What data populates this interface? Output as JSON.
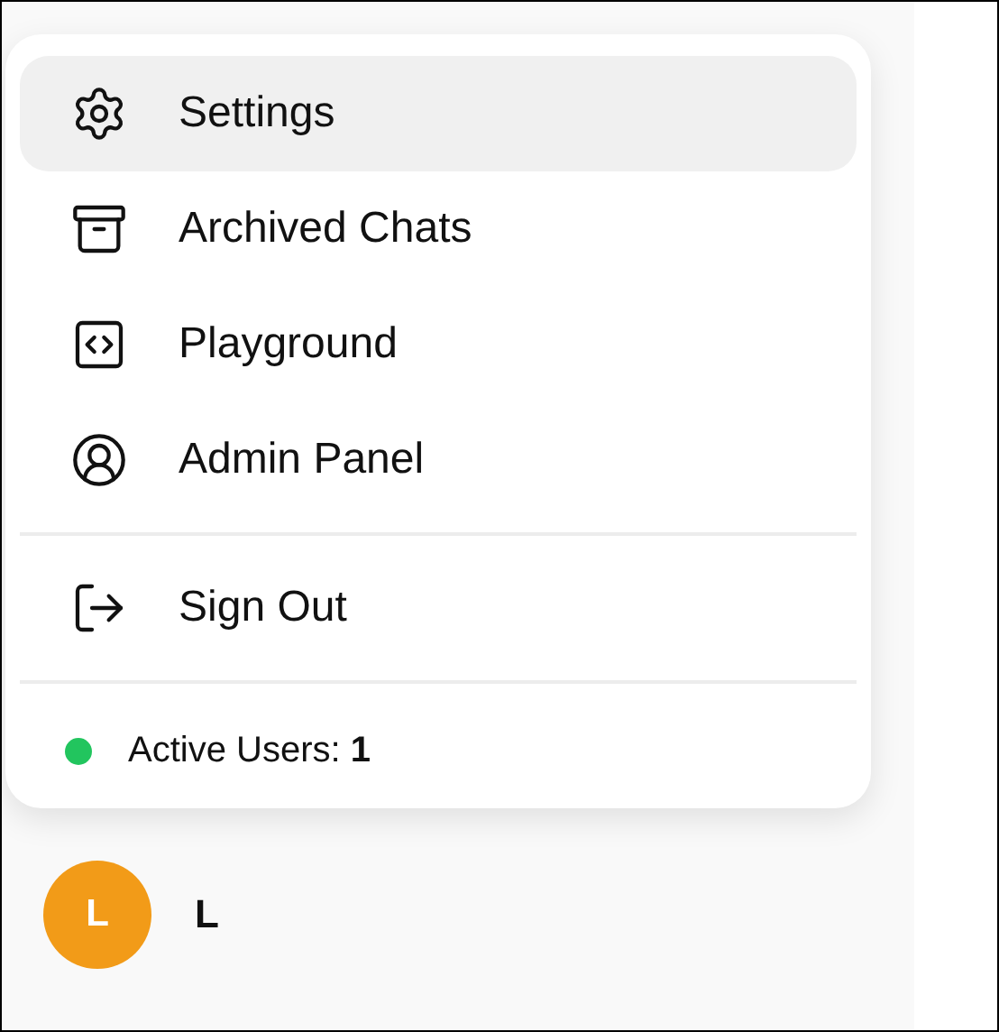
{
  "menu": {
    "groups": [
      {
        "items": [
          {
            "kind": "settings",
            "label": "Settings",
            "selected": true
          },
          {
            "kind": "archive",
            "label": "Archived Chats",
            "selected": false
          },
          {
            "kind": "code",
            "label": "Playground",
            "selected": false
          },
          {
            "kind": "user",
            "label": "Admin Panel",
            "selected": false
          }
        ]
      },
      {
        "items": [
          {
            "kind": "logout",
            "label": "Sign Out",
            "selected": false
          }
        ]
      }
    ],
    "status": {
      "text": "Active Users: **1**",
      "color": "#22c55e"
    }
  },
  "user": {
    "initial": "L",
    "name": "L"
  }
}
